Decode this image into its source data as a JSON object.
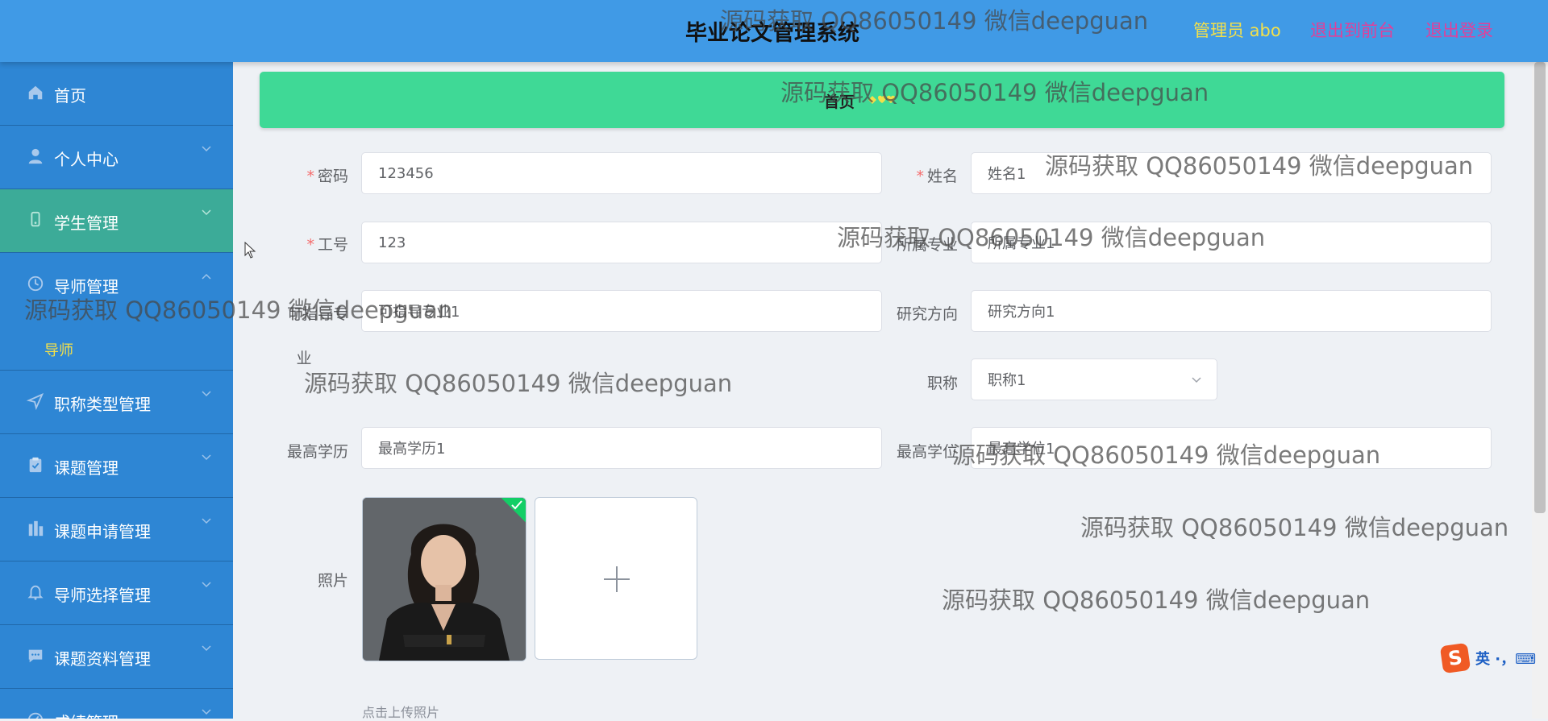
{
  "header": {
    "title": "毕业论文管理系统",
    "admin": "管理员 abo",
    "front_link": "退出到前台",
    "logout_link": "退出登录"
  },
  "sidebar": {
    "items": [
      {
        "label": "首页",
        "icon": "home-icon",
        "arrow": false
      },
      {
        "label": "个人中心",
        "icon": "user-icon",
        "arrow": true
      },
      {
        "label": "学生管理",
        "icon": "student-icon",
        "arrow": true,
        "active": true
      },
      {
        "label": "导师管理",
        "icon": "clock-icon",
        "arrow": true,
        "expanded": true,
        "children": [
          "导师"
        ]
      },
      {
        "label": "职称类型管理",
        "icon": "navigation-icon",
        "arrow": true
      },
      {
        "label": "课题管理",
        "icon": "clipboard-icon",
        "arrow": true
      },
      {
        "label": "课题申请管理",
        "icon": "chart-bar-icon",
        "arrow": true
      },
      {
        "label": "导师选择管理",
        "icon": "bell-icon",
        "arrow": true
      },
      {
        "label": "课题资料管理",
        "icon": "message-icon",
        "arrow": true
      },
      {
        "label": "成绩管理",
        "icon": "gauge-icon",
        "arrow": true
      }
    ]
  },
  "breadcrumb": {
    "home": "首页"
  },
  "form": {
    "password": {
      "label": "密码",
      "required": true,
      "value": "123456"
    },
    "name": {
      "label": "姓名",
      "required": true,
      "value": "姓名1"
    },
    "job_number": {
      "label": "工号",
      "required": true,
      "value": "123"
    },
    "major": {
      "label": "所属专业",
      "value": "所属专业1"
    },
    "teaching_major": {
      "label_line1": "可指导专",
      "label_line2": "业",
      "value": "可指导专业1"
    },
    "research": {
      "label": "研究方向",
      "value": "研究方向1"
    },
    "title": {
      "label": "职称",
      "value": "职称1"
    },
    "education": {
      "label": "最高学历",
      "value": "最高学历1"
    },
    "degree": {
      "label": "最高学位",
      "value": "最高学位1"
    },
    "photo": {
      "label": "照片",
      "upload_tip": "点击上传照片"
    }
  },
  "ime": {
    "logo": "S",
    "text": "英 ·，⌨"
  },
  "watermark": "源码获取 QQ86050149 微信deepguan",
  "colors": {
    "header": "#409ae6",
    "sidebar": "#2e86d4",
    "sidebar_active": "#3cab98",
    "breadcrumb": "#3fd996",
    "accent_yellow": "#f3e04a",
    "accent_pink": "#e0409a"
  }
}
